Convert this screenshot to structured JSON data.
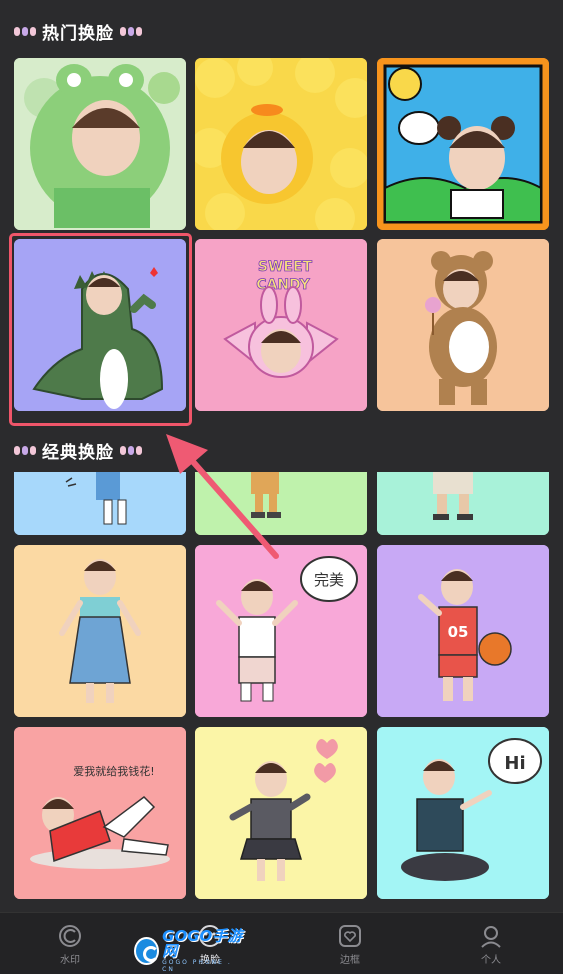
{
  "sections": {
    "hot": {
      "title": "热门换脸"
    },
    "classic": {
      "title": "经典换脸"
    }
  },
  "hot_templates": [
    {
      "name": "frog-hood",
      "bg": "#cfe9c4"
    },
    {
      "name": "duck-hood",
      "bg": "#f9d84a"
    },
    {
      "name": "bear-ears-sun",
      "bg": "#f7941d"
    },
    {
      "name": "dinosaur",
      "bg": "#a6a4f5",
      "selected": true
    },
    {
      "name": "bunny-candy",
      "bg": "#f6a3c6",
      "text": "SWEET\nCANDY"
    },
    {
      "name": "bear-costume",
      "bg": "#f6c49b"
    }
  ],
  "classic_templates": [
    {
      "name": "blue-partial",
      "bg": "#a7d8fb"
    },
    {
      "name": "green-partial",
      "bg": "#bff2ac"
    },
    {
      "name": "mint-partial",
      "bg": "#a8f2d9"
    },
    {
      "name": "overalls-girl",
      "bg": "#fbd9a3"
    },
    {
      "name": "perfect-pose",
      "bg": "#f8a8d8",
      "text": "完美"
    },
    {
      "name": "basketball",
      "bg": "#c8a9f5",
      "text": "05"
    },
    {
      "name": "lying-flowers",
      "bg": "#f9a3a3",
      "text": "爱我就给我钱花!"
    },
    {
      "name": "school-uniform",
      "bg": "#fbf5a7"
    },
    {
      "name": "hi-sitting",
      "bg": "#a3f5f5",
      "text": "Hi"
    }
  ],
  "bottom_nav": [
    {
      "label": "水印",
      "icon": "watermark-icon"
    },
    {
      "label": "换脸",
      "icon": "face-swap-icon"
    },
    {
      "label": "边框",
      "icon": "frame-icon"
    },
    {
      "label": "个人",
      "icon": "profile-icon"
    }
  ],
  "watermark": {
    "main": "GOGO手游网",
    "sub": "GOGO PHONE . CN"
  },
  "colors": {
    "background": "#2b2b2d",
    "selection": "#f0566a",
    "arrow": "#ef5a73"
  }
}
